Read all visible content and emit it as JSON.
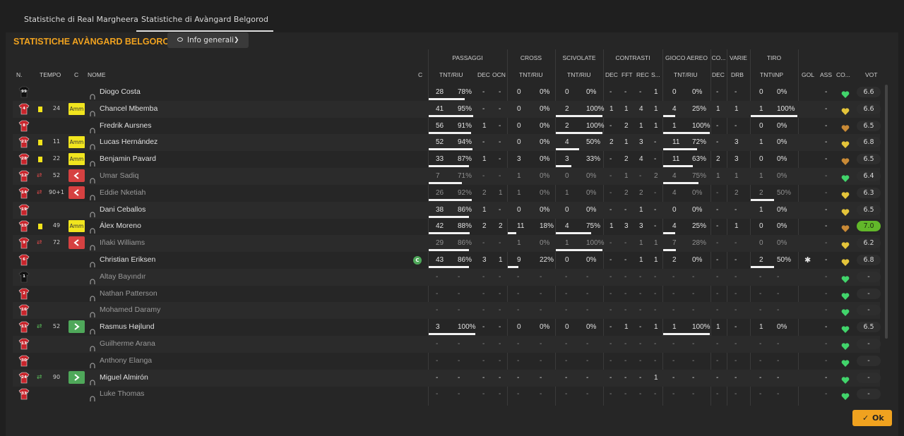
{
  "tabs": [
    "Statistiche di Real Margheera",
    "Statistiche di Avàngard Belgorod"
  ],
  "section_title": "STATISTICHE AVÀNGARD BELGOROD",
  "view_button": "Info generali",
  "ok_button": "Ok",
  "group_headers": {
    "passaggi": "PASSAGGI",
    "cross": "CROSS",
    "scivolate": "SCIVOLATE",
    "contrasti": "CONTRASTI",
    "gioco_aereo": "GIOCO AEREO",
    "co": "CO...",
    "varie": "VARIE",
    "tiro": "TIRO"
  },
  "columns": {
    "n": "N.",
    "tempo": "TEMPO",
    "c": "C",
    "nome": "NOME",
    "cap": "C",
    "pass_tnt": "TNT/RIU",
    "pass_dec": "DEC",
    "pass_ocn": "OCN",
    "cross_tnt": "TNT/RIU",
    "sciv_tnt": "TNT/RIU",
    "con_dec": "DEC",
    "con_fft": "FFT",
    "con_rec": "REC",
    "con_s": "S...",
    "aereo_tnt": "TNT/RIU",
    "co_dec": "DEC",
    "varie_drb": "DRB",
    "tiro_tnt": "TNT\\INP",
    "gol": "GOL",
    "ass": "ASS",
    "cond": "CO...",
    "vot": "VOT"
  },
  "colors": {
    "accent": "#f0a21f",
    "card": "#f2e31b",
    "sub_out": "#d64141",
    "sub_in": "#4fa85a",
    "heart_green": "#41d46b",
    "heart_yellow": "#e4c43a",
    "heart_brown": "#c98a36"
  },
  "players": [
    {
      "num": "99",
      "kit": "gk",
      "name": "Diogo Costa",
      "dim": false,
      "card": false,
      "sub": "",
      "tempo": "",
      "pass": [
        "28",
        "78%",
        "-",
        "-"
      ],
      "cross": [
        "0",
        "0%"
      ],
      "sciv": [
        "0",
        "0%"
      ],
      "con": [
        "-",
        "-",
        "-",
        "1"
      ],
      "aereo": [
        "0",
        "0%"
      ],
      "co": "-",
      "drb": "-",
      "tiro": [
        "0",
        "0%"
      ],
      "gol": "",
      "ass": "-",
      "heart": "green",
      "vote": "6.6"
    },
    {
      "num": "4",
      "kit": "field",
      "name": "Chancel Mbemba",
      "dim": false,
      "card": true,
      "sub": "amm",
      "tempo": "24",
      "pass": [
        "41",
        "95%",
        "-",
        "-"
      ],
      "cross": [
        "0",
        "0%"
      ],
      "sciv": [
        "2",
        "100%"
      ],
      "con": [
        "1",
        "1",
        "4",
        "1"
      ],
      "aereo": [
        "4",
        "25%"
      ],
      "co": "1",
      "drb": "1",
      "tiro": [
        "1",
        "100%"
      ],
      "gol": "",
      "ass": "-",
      "heart": "yellow",
      "vote": "6.6"
    },
    {
      "num": "8",
      "kit": "field",
      "name": "Fredrik Aursnes",
      "dim": false,
      "card": false,
      "sub": "",
      "tempo": "",
      "pass": [
        "56",
        "91%",
        "1",
        "-"
      ],
      "cross": [
        "0",
        "0%"
      ],
      "sciv": [
        "2",
        "100%"
      ],
      "con": [
        "-",
        "2",
        "1",
        "1"
      ],
      "aereo": [
        "1",
        "100%"
      ],
      "co": "-",
      "drb": "-",
      "tiro": [
        "0",
        "0%"
      ],
      "gol": "",
      "ass": "-",
      "heart": "brown",
      "vote": "6.5"
    },
    {
      "num": "21",
      "kit": "field",
      "name": "Lucas Hernández",
      "dim": false,
      "card": true,
      "sub": "amm",
      "tempo": "11",
      "pass": [
        "52",
        "94%",
        "-",
        "-"
      ],
      "cross": [
        "0",
        "0%"
      ],
      "sciv": [
        "4",
        "50%"
      ],
      "con": [
        "2",
        "1",
        "3",
        "-"
      ],
      "aereo": [
        "11",
        "72%"
      ],
      "co": "-",
      "drb": "3",
      "tiro": [
        "1",
        "0%"
      ],
      "gol": "",
      "ass": "-",
      "heart": "yellow",
      "vote": "6.8"
    },
    {
      "num": "28",
      "kit": "field",
      "name": "Benjamin Pavard",
      "dim": false,
      "card": true,
      "sub": "amm",
      "tempo": "22",
      "pass": [
        "33",
        "87%",
        "1",
        "-"
      ],
      "cross": [
        "3",
        "0%"
      ],
      "sciv": [
        "3",
        "33%"
      ],
      "con": [
        "-",
        "2",
        "4",
        "-"
      ],
      "aereo": [
        "11",
        "63%"
      ],
      "co": "2",
      "drb": "3",
      "tiro": [
        "0",
        "0%"
      ],
      "gol": "",
      "ass": "-",
      "heart": "brown",
      "vote": "6.5"
    },
    {
      "num": "12",
      "kit": "field",
      "name": "Umar Sadiq",
      "dim": true,
      "card": false,
      "sub": "out",
      "tempo": "52",
      "pass": [
        "7",
        "71%",
        "-",
        "-"
      ],
      "cross": [
        "1",
        "0%"
      ],
      "sciv": [
        "0",
        "0%"
      ],
      "con": [
        "-",
        "1",
        "-",
        "2"
      ],
      "aereo": [
        "4",
        "75%"
      ],
      "co": "1",
      "drb": "1",
      "tiro": [
        "1",
        "0%"
      ],
      "gol": "",
      "ass": "-",
      "heart": "green",
      "vote": "6.4"
    },
    {
      "num": "14",
      "kit": "field",
      "name": "Eddie Nketiah",
      "dim": true,
      "card": false,
      "sub": "out",
      "tempo": "90+1",
      "pass": [
        "26",
        "92%",
        "2",
        "1"
      ],
      "cross": [
        "1",
        "0%"
      ],
      "sciv": [
        "1",
        "0%"
      ],
      "con": [
        "-",
        "2",
        "2",
        "-"
      ],
      "aereo": [
        "4",
        "0%"
      ],
      "co": "-",
      "drb": "2",
      "tiro": [
        "2",
        "50%"
      ],
      "gol": "",
      "ass": "-",
      "heart": "yellow",
      "vote": "6.3"
    },
    {
      "num": "19",
      "kit": "field",
      "name": "Dani Ceballos",
      "dim": false,
      "card": false,
      "sub": "",
      "tempo": "",
      "pass": [
        "38",
        "86%",
        "1",
        "-"
      ],
      "cross": [
        "0",
        "0%"
      ],
      "sciv": [
        "0",
        "0%"
      ],
      "con": [
        "-",
        "-",
        "1",
        "-"
      ],
      "aereo": [
        "0",
        "0%"
      ],
      "co": "-",
      "drb": "-",
      "tiro": [
        "1",
        "0%"
      ],
      "gol": "",
      "ass": "-",
      "heart": "yellow",
      "vote": "6.5"
    },
    {
      "num": "15",
      "kit": "field",
      "name": "Álex Moreno",
      "dim": false,
      "card": true,
      "sub": "amm",
      "tempo": "49",
      "pass": [
        "42",
        "88%",
        "2",
        "2"
      ],
      "cross": [
        "11",
        "18%"
      ],
      "sciv": [
        "4",
        "75%"
      ],
      "con": [
        "1",
        "3",
        "3",
        "-"
      ],
      "aereo": [
        "4",
        "25%"
      ],
      "co": "-",
      "drb": "1",
      "tiro": [
        "0",
        "0%"
      ],
      "gol": "",
      "ass": "-",
      "heart": "brown",
      "vote": "7.0",
      "best": true
    },
    {
      "num": "9",
      "kit": "field",
      "name": "Iñaki Williams",
      "dim": true,
      "card": false,
      "sub": "out",
      "tempo": "72",
      "pass": [
        "29",
        "86%",
        "-",
        "-"
      ],
      "cross": [
        "1",
        "0%"
      ],
      "sciv": [
        "1",
        "100%"
      ],
      "con": [
        "-",
        "-",
        "1",
        "1"
      ],
      "aereo": [
        "7",
        "28%"
      ],
      "co": "-",
      "drb": "-",
      "tiro": [
        "0",
        "0%"
      ],
      "gol": "",
      "ass": "-",
      "heart": "yellow",
      "vote": "6.2"
    },
    {
      "num": "6",
      "kit": "field",
      "name": "Christian Eriksen",
      "dim": false,
      "card": false,
      "sub": "",
      "tempo": "",
      "captain": "C",
      "pass": [
        "43",
        "86%",
        "3",
        "1"
      ],
      "cross": [
        "9",
        "22%"
      ],
      "sciv": [
        "0",
        "0%"
      ],
      "con": [
        "-",
        "-",
        "1",
        "1"
      ],
      "aereo": [
        "2",
        "0%"
      ],
      "co": "-",
      "drb": "-",
      "tiro": [
        "2",
        "50%"
      ],
      "gol": "gear",
      "ass": "-",
      "heart": "yellow",
      "vote": "6.8"
    },
    {
      "num": "1",
      "kit": "gk",
      "name": "Altay Bayındır",
      "dim": true,
      "card": false,
      "sub": "",
      "tempo": "",
      "pass": [
        "-",
        "-",
        "-",
        "-"
      ],
      "cross": [
        "-",
        "-"
      ],
      "sciv": [
        "-",
        "-"
      ],
      "con": [
        "-",
        "-",
        "-",
        "-"
      ],
      "aereo": [
        "-",
        "-"
      ],
      "co": "-",
      "drb": "-",
      "tiro": [
        "-",
        "-"
      ],
      "gol": "",
      "ass": "-",
      "heart": "green",
      "vote": "-"
    },
    {
      "num": "2",
      "kit": "field",
      "name": "Nathan Patterson",
      "dim": true,
      "card": false,
      "sub": "",
      "tempo": "",
      "pass": [
        "-",
        "-",
        "-",
        "-"
      ],
      "cross": [
        "-",
        "-"
      ],
      "sciv": [
        "-",
        "-"
      ],
      "con": [
        "-",
        "-",
        "-",
        "-"
      ],
      "aereo": [
        "-",
        "-"
      ],
      "co": "-",
      "drb": "-",
      "tiro": [
        "-",
        "-"
      ],
      "gol": "",
      "ass": "-",
      "heart": "green",
      "vote": "-"
    },
    {
      "num": "16",
      "kit": "field",
      "name": "Mohamed Daramy",
      "dim": true,
      "card": false,
      "sub": "",
      "tempo": "",
      "pass": [
        "-",
        "-",
        "-",
        "-"
      ],
      "cross": [
        "-",
        "-"
      ],
      "sciv": [
        "-",
        "-"
      ],
      "con": [
        "-",
        "-",
        "-",
        "-"
      ],
      "aereo": [
        "-",
        "-"
      ],
      "co": "-",
      "drb": "-",
      "tiro": [
        "-",
        "-"
      ],
      "gol": "",
      "ass": "-",
      "heart": "green",
      "vote": "-"
    },
    {
      "num": "11",
      "kit": "field",
      "name": "Rasmus Højlund",
      "dim": false,
      "card": false,
      "sub": "in",
      "tempo": "52",
      "pass": [
        "3",
        "100%",
        "-",
        "-"
      ],
      "cross": [
        "0",
        "0%"
      ],
      "sciv": [
        "0",
        "0%"
      ],
      "con": [
        "-",
        "1",
        "-",
        "1"
      ],
      "aereo": [
        "1",
        "100%"
      ],
      "co": "1",
      "drb": "-",
      "tiro": [
        "1",
        "0%"
      ],
      "gol": "",
      "ass": "-",
      "heart": "green",
      "vote": "6.5"
    },
    {
      "num": "13",
      "kit": "field",
      "name": "Guilherme Arana",
      "dim": true,
      "card": false,
      "sub": "",
      "tempo": "",
      "pass": [
        "-",
        "-",
        "-",
        "-"
      ],
      "cross": [
        "-",
        "-"
      ],
      "sciv": [
        "-",
        "-"
      ],
      "con": [
        "-",
        "-",
        "-",
        "-"
      ],
      "aereo": [
        "-",
        "-"
      ],
      "co": "-",
      "drb": "-",
      "tiro": [
        "-",
        "-"
      ],
      "gol": "",
      "ass": "-",
      "heart": "green",
      "vote": "-"
    },
    {
      "num": "30",
      "kit": "field",
      "name": "Anthony Elanga",
      "dim": true,
      "card": false,
      "sub": "",
      "tempo": "",
      "pass": [
        "-",
        "-",
        "-",
        "-"
      ],
      "cross": [
        "-",
        "-"
      ],
      "sciv": [
        "-",
        "-"
      ],
      "con": [
        "-",
        "-",
        "-",
        "-"
      ],
      "aereo": [
        "-",
        "-"
      ],
      "co": "-",
      "drb": "-",
      "tiro": [
        "-",
        "-"
      ],
      "gol": "",
      "ass": "-",
      "heart": "green",
      "vote": "-"
    },
    {
      "num": "24",
      "kit": "field",
      "name": "Miguel Almirón",
      "dim": false,
      "card": false,
      "sub": "in",
      "tempo": "90",
      "pass": [
        "-",
        "-",
        "-",
        "-"
      ],
      "cross": [
        "-",
        "-"
      ],
      "sciv": [
        "-",
        "-"
      ],
      "con": [
        "-",
        "-",
        "-",
        "1"
      ],
      "aereo": [
        "-",
        "-"
      ],
      "co": "-",
      "drb": "-",
      "tiro": [
        "-",
        "-"
      ],
      "gol": "",
      "ass": "-",
      "heart": "green",
      "vote": "-"
    },
    {
      "num": "33",
      "kit": "field",
      "name": "Luke Thomas",
      "dim": true,
      "card": false,
      "sub": "",
      "tempo": "",
      "pass": [
        "-",
        "-",
        "-",
        "-"
      ],
      "cross": [
        "-",
        "-"
      ],
      "sciv": [
        "-",
        "-"
      ],
      "con": [
        "-",
        "-",
        "-",
        "-"
      ],
      "aereo": [
        "-",
        "-"
      ],
      "co": "-",
      "drb": "-",
      "tiro": [
        "-",
        "-"
      ],
      "gol": "",
      "ass": "-",
      "heart": "green",
      "vote": "-"
    }
  ]
}
